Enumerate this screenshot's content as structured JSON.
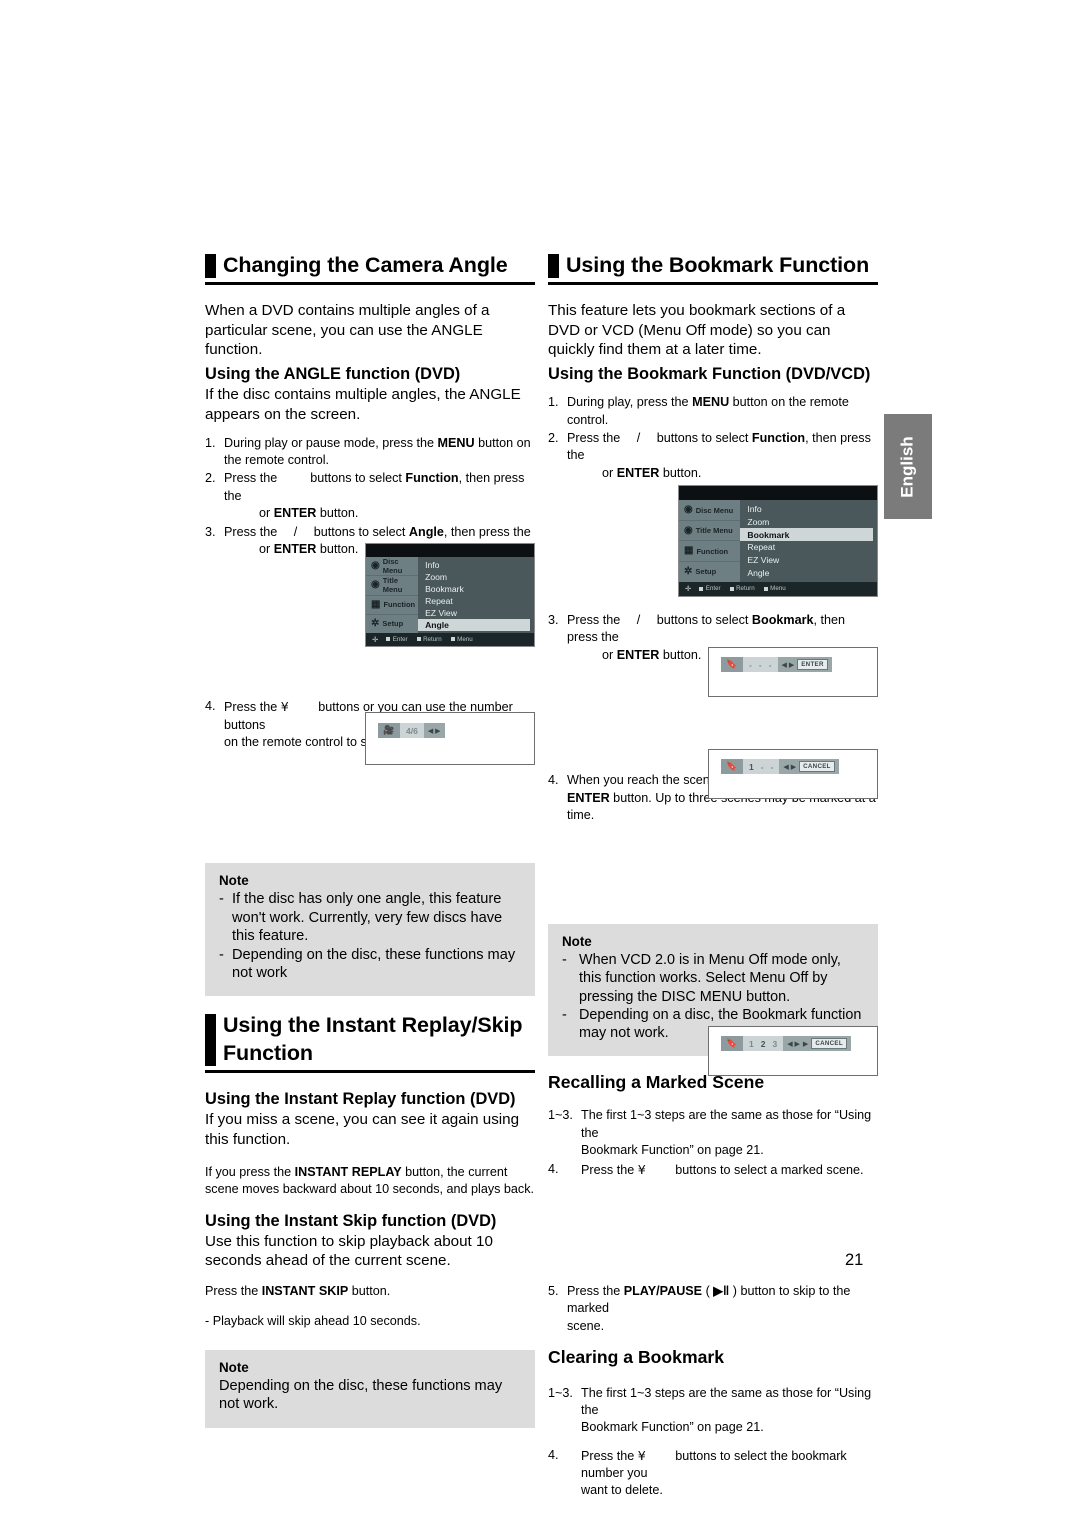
{
  "page": {
    "number": "21",
    "language_tab": "English"
  },
  "left_column": {
    "section1": {
      "heading": "Changing the Camera Angle",
      "intro": "When a DVD contains multiple angles of a particular scene, you can use the ANGLE function.",
      "sub_heading": "Using the ANGLE function (DVD)",
      "sub_text": "If the disc contains multiple angles, the ANGLE appears on the screen.",
      "steps": [
        {
          "num": "1.",
          "parts": [
            "During play or pause mode, press the ",
            "MENU",
            " button on the remote control."
          ]
        },
        {
          "num": "2.",
          "line1_a": "Press the ",
          "line1_b": " buttons to select ",
          "line1_bold": "Function",
          "line1_c": ", then press the",
          "line2_a": "or ",
          "line2_bold": "ENTER",
          "line2_b": " button."
        },
        {
          "num": "3.",
          "line1_a": "Press the ",
          "line1_sep": "/",
          "line1_b": " buttons to select ",
          "line1_bold": "Angle",
          "line1_c": ", then press the",
          "line2_a": "or ",
          "line2_bold": "ENTER",
          "line2_b": " button."
        },
        {
          "num": "4.",
          "line1_a": "Press the ",
          "line1_glyph": "¥",
          "line1_b": " buttons or you can use the number buttons",
          "line2": "on the remote control to select the desired angle."
        }
      ],
      "osd": {
        "left_items": [
          "Disc Menu",
          "Title Menu",
          "Function",
          "Setup"
        ],
        "menu_items": [
          "Info",
          "Zoom",
          "Bookmark",
          "Repeat",
          "EZ View",
          "Angle"
        ],
        "selected": "Angle",
        "bottom_bar": [
          "Enter",
          "Return",
          "Menu"
        ]
      },
      "angle_indicator": {
        "icon": "camera-icon",
        "value": "4/6",
        "arrows": "◀ ▶"
      },
      "note": {
        "title": "Note",
        "items": [
          "If the disc has only one angle, this feature won't work. Currently, very few discs have this feature.",
          "Depending on the disc, these functions may not work"
        ]
      }
    },
    "section2": {
      "heading": "Using the Instant Replay/Skip Function",
      "sub_heading1": "Using the Instant Replay function (DVD)",
      "text1": "If you miss a scene, you can see it again using this function.",
      "small1_a": "If you press the ",
      "small1_bold": "INSTANT REPLAY",
      "small1_b": " button, the current scene moves backward about 10 seconds, and plays back.",
      "sub_heading2": "Using the Instant Skip function (DVD)",
      "text2": "Use this function to skip playback about 10 seconds ahead of the current scene.",
      "small2_a": "Press the ",
      "small2_bold": "INSTANT SKIP",
      "small2_b": " button.",
      "small3": "- Playback will skip ahead 10 seconds.",
      "note": {
        "title": "Note",
        "text": "Depending on the disc, these functions may not work."
      }
    }
  },
  "right_column": {
    "section1": {
      "heading": "Using the Bookmark Function",
      "intro": "This feature lets you bookmark sections of a DVD or VCD (Menu Off mode) so you can quickly find them at a later time.",
      "sub_heading": "Using the Bookmark Function (DVD/VCD)",
      "steps": [
        {
          "num": "1.",
          "a": "During play, press the ",
          "bold": "MENU",
          "b": " button on the remote control."
        },
        {
          "num": "2.",
          "line1_a": "Press the ",
          "line1_sep": "/",
          "line1_b": " buttons to select ",
          "line1_bold": "Function",
          "line1_c": ", then  press the",
          "line2_a": "or ",
          "line2_bold": "ENTER",
          "line2_b": " button."
        },
        {
          "num": "3.",
          "line1_a": "Press the ",
          "line1_sep": "/",
          "line1_b": " buttons to select ",
          "line1_bold": "Bookmark",
          "line1_c": ", then press the",
          "line2_a": "or ",
          "line2_bold": "ENTER",
          "line2_b": " button."
        },
        {
          "num": "4.",
          "line1": "When you reach the scene you want to mark, press the",
          "line2_bold": "ENTER",
          "line2_b": " button. Up to three scenes may be marked at a time."
        }
      ],
      "osd": {
        "left_items": [
          "Disc Menu",
          "Title Menu",
          "Function",
          "Setup"
        ],
        "menu_items": [
          "Info",
          "Zoom",
          "Bookmark",
          "Repeat",
          "EZ View",
          "Angle"
        ],
        "selected": "Bookmark",
        "bottom_bar": [
          "Enter",
          "Return",
          "Menu"
        ]
      },
      "bookmark_indicator_empty": {
        "icon": "bookmark-icon",
        "slots": [
          "-",
          "-",
          "-"
        ],
        "arrows": "◀ ▶",
        "button": "ENTER"
      },
      "bookmark_indicator_one": {
        "icon": "bookmark-icon",
        "slots": [
          "1",
          "-",
          "-"
        ],
        "arrows": "◀ ▶",
        "button": "CANCEL"
      },
      "note": {
        "title": "Note",
        "items": [
          "When VCD 2.0 is in Menu Off mode only, this function works. Select Menu Off by pressing the DISC MENU button.",
          "Depending on a disc, the Bookmark function may not work."
        ]
      }
    },
    "section2": {
      "heading": "Recalling a Marked Scene",
      "steps": [
        {
          "num": "1~3.",
          "line1": "The first 1~3 steps are the same as those for “Using the",
          "line2": "Bookmark Function” on page 21."
        },
        {
          "num": "4.",
          "a": "Press the ",
          "glyph": "¥",
          "b": " buttons to select a marked scene."
        }
      ],
      "bookmark_indicator_three": {
        "icon": "bookmark-icon",
        "slots": [
          "1",
          "2",
          "3"
        ],
        "arrows": "◀ ▶",
        "play_icon": "▶",
        "button": "CANCEL"
      },
      "step5": {
        "num": "5.",
        "a": "Press the ",
        "bold": "PLAY/PAUSE",
        "paren_open": " ( ",
        "glyph": "▶‖",
        "paren_close": " ) ",
        "b": "button to skip to the marked",
        "line2": "scene."
      }
    },
    "section3": {
      "heading": "Clearing a Bookmark",
      "steps": [
        {
          "num": "1~3.",
          "line1": "The first 1~3 steps are the same as those for  “Using the",
          "line2": "Bookmark Function” on page 21."
        },
        {
          "num": "4.",
          "a": "Press the ",
          "glyph": "¥",
          "b": " buttons to select the bookmark number you",
          "line2": "want to delete."
        }
      ]
    }
  }
}
